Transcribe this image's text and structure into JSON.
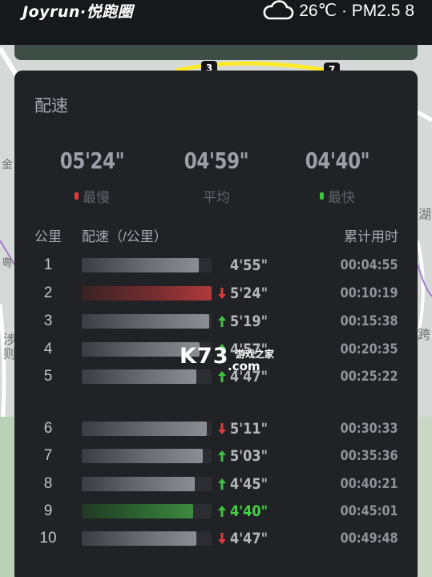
{
  "header": {
    "brand": "Joyrun·悦跑圈",
    "weather_icon": "cloud-icon",
    "weather_text": "26℃ · PM2.5 8"
  },
  "map": {
    "labels": [
      "金",
      "湖",
      "涉",
      "则",
      "粤",
      "跨"
    ],
    "markers": [
      "3",
      "7"
    ]
  },
  "panel": {
    "title": "配速",
    "stats": [
      {
        "value": "05'24\"",
        "label": "最慢",
        "dot_color": "#e23a3a"
      },
      {
        "value": "04'59\"",
        "label": "平均",
        "dot_color": ""
      },
      {
        "value": "04'40\"",
        "label": "最快",
        "dot_color": "#3cc43c"
      }
    ],
    "columns": {
      "km": "公里",
      "pace": "配速（/公里）",
      "cumulative": "累计用时"
    },
    "rows": [
      {
        "km": "1",
        "pace": "4'55\"",
        "cumulative": "00:04:55",
        "trend": "none",
        "fill": 0.9,
        "kind": "normal"
      },
      {
        "km": "2",
        "pace": "5'24\"",
        "cumulative": "00:10:19",
        "trend": "down",
        "fill": 1.0,
        "kind": "slow"
      },
      {
        "km": "3",
        "pace": "5'19\"",
        "cumulative": "00:15:38",
        "trend": "up",
        "fill": 0.98,
        "kind": "normal"
      },
      {
        "km": "4",
        "pace": "4'57\"",
        "cumulative": "00:20:35",
        "trend": "up",
        "fill": 0.91,
        "kind": "normal"
      },
      {
        "km": "5",
        "pace": "4'47\"",
        "cumulative": "00:25:22",
        "trend": "up",
        "fill": 0.88,
        "kind": "normal"
      },
      {
        "km": "6",
        "pace": "5'11\"",
        "cumulative": "00:30:33",
        "trend": "down",
        "fill": 0.96,
        "kind": "normal"
      },
      {
        "km": "7",
        "pace": "5'03\"",
        "cumulative": "00:35:36",
        "trend": "up",
        "fill": 0.93,
        "kind": "normal"
      },
      {
        "km": "8",
        "pace": "4'45\"",
        "cumulative": "00:40:21",
        "trend": "up",
        "fill": 0.87,
        "kind": "normal"
      },
      {
        "km": "9",
        "pace": "4'40\"",
        "cumulative": "00:45:01",
        "trend": "up",
        "fill": 0.86,
        "kind": "best"
      },
      {
        "km": "10",
        "pace": "4'47\"",
        "cumulative": "00:49:48",
        "trend": "down",
        "fill": 0.88,
        "kind": "normal"
      }
    ]
  },
  "watermark": {
    "big": "K73",
    "top": "游戏之家",
    "sub": ".com"
  },
  "colors": {
    "up": "#3cc43c",
    "down": "#e23a3a",
    "best": "#41d343",
    "panel": "#202226"
  }
}
